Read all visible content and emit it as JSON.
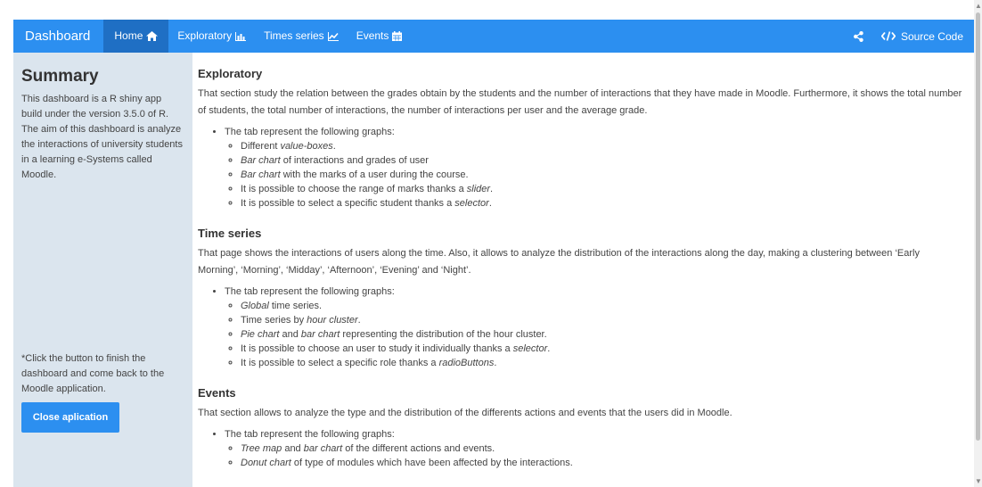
{
  "navbar": {
    "brand": "Dashboard",
    "tabs": [
      {
        "label": "Home",
        "icon": "home-icon",
        "active": true
      },
      {
        "label": "Exploratory",
        "icon": "bar-chart-icon",
        "active": false
      },
      {
        "label": "Times series",
        "icon": "line-chart-icon",
        "active": false
      },
      {
        "label": "Events",
        "icon": "calendar-icon",
        "active": false
      }
    ],
    "share_icon": "share-icon",
    "source_code_label": "Source Code",
    "source_code_icon": "code-icon"
  },
  "sidebar": {
    "title": "Summary",
    "description": "This dashboard is a R shiny app build under the version 3.5.0 of R. The aim of this dashboard is analyze the interactions of university students in a learning e-Systems called Moodle.",
    "note": "*Click the button to finish the dashboard and come back to the Moodle application.",
    "close_button": "Close aplication"
  },
  "main": {
    "sections": [
      {
        "title": "Exploratory",
        "text": "That section study the relation between the grades obtain by the students and the number of interactions that they have made in Moodle. Furthermore, it shows the total number of students, the total number of interactions, the number of interactions per user and the average grade.",
        "bullet": "The tab represent the following graphs:",
        "items": [
          {
            "pre": "Different ",
            "em": "value-boxes",
            "post": "."
          },
          {
            "pre": "",
            "em": "Bar chart",
            "post": " of interactions and grades of user"
          },
          {
            "pre": "",
            "em": "Bar chart",
            "post": " with the marks of a user during the course."
          },
          {
            "pre": "It is possible to choose the range of marks thanks a ",
            "em": "slider",
            "post": "."
          },
          {
            "pre": "It is possible to select a specific student thanks a ",
            "em": "selector",
            "post": "."
          }
        ]
      },
      {
        "title": "Time series",
        "text": "That page shows the interactions of users along the time. Also, it allows to analyze the distribution of the interactions along the day, making a clustering between ‘Early Morning’, ‘Morning’, ‘Midday’, ‘Afternoon’, ‘Evening’ and ‘Night’.",
        "bullet": "The tab represent the following graphs:",
        "items": [
          {
            "pre": "",
            "em": "Global",
            "post": " time series."
          },
          {
            "pre": "Time series by ",
            "em": "hour cluster",
            "post": "."
          },
          {
            "pre": "",
            "em": "Pie chart",
            "post": " and ",
            "em2": "bar chart",
            "post2": " representing the distribution of the hour cluster."
          },
          {
            "pre": "It is possible to choose an user to study it individually thanks a ",
            "em": "selector",
            "post": "."
          },
          {
            "pre": "It is possible to select a specific role thanks a ",
            "em": "radioButtons",
            "post": "."
          }
        ]
      },
      {
        "title": "Events",
        "text": "That section allows to analyze the type and the distribution of the differents actions and events that the users did in Moodle.",
        "bullet": "The tab represent the following graphs:",
        "items": [
          {
            "pre": "",
            "em": "Tree map",
            "post": " and ",
            "em2": "bar chart",
            "post2": " of the different actions and events."
          },
          {
            "pre": "",
            "em": "Donut chart",
            "post": " of type of modules which have been affected by the interactions."
          }
        ]
      }
    ]
  },
  "colors": {
    "navbar": "#2c8ff0",
    "navbar_active": "#1f6fc4",
    "sidebar": "#dbe5ee",
    "button": "#2c8ff0"
  }
}
